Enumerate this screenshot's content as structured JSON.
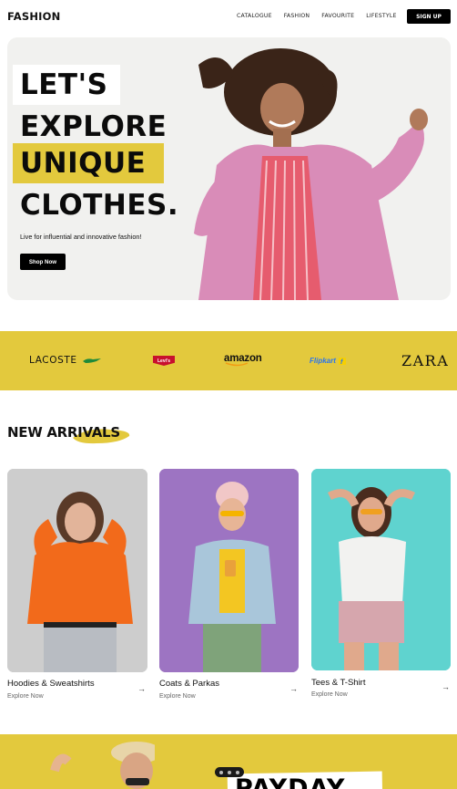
{
  "nav": {
    "logo": "FASHION",
    "links": [
      "CATALOGUE",
      "FASHION",
      "FAVOURITE",
      "LIFESTYLE"
    ],
    "signup_label": "SIGN UP"
  },
  "hero": {
    "lines": [
      "LET'S",
      "EXPLORE",
      "UNIQUE",
      "CLOTHES."
    ],
    "subtitle": "Live for influential and innovative fashion!",
    "cta_label": "Shop Now",
    "accent_color": "#e3c93d"
  },
  "brands": {
    "items": [
      "LACOSTE",
      "Levi's",
      "amazon",
      "Flipkart",
      "ZARA"
    ],
    "band_color": "#e3c93d"
  },
  "arrivals": {
    "title": "NEW ARRIVALS",
    "cards": [
      {
        "title": "Hoodies & Sweatshirts",
        "sub": "Explore Now",
        "arrow": "→",
        "image": "woman-orange-hoodie-photo"
      },
      {
        "title": "Coats & Parkas",
        "sub": "Explore Now",
        "arrow": "→",
        "image": "woman-denim-jacket-photo"
      },
      {
        "title": "Tees & T-Shirt",
        "sub": "Explore Now",
        "arrow": "→",
        "image": "woman-white-tee-photo"
      }
    ]
  },
  "promo": {
    "title": "PAYDAY"
  }
}
